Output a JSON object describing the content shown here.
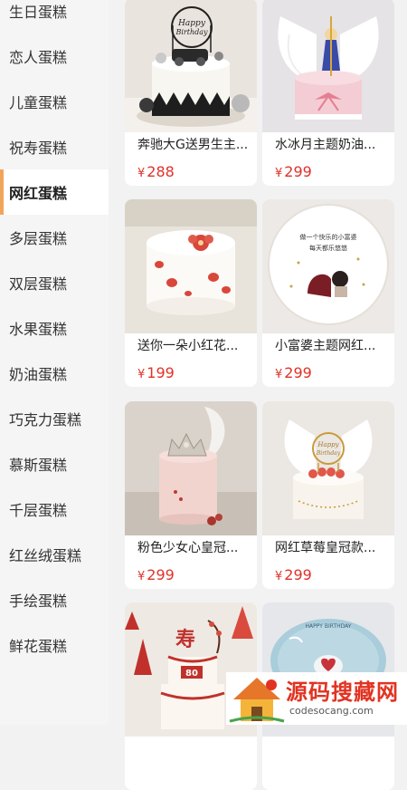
{
  "sidebar": {
    "items": [
      {
        "label": "生日蛋糕"
      },
      {
        "label": "恋人蛋糕"
      },
      {
        "label": "儿童蛋糕"
      },
      {
        "label": "祝寿蛋糕"
      },
      {
        "label": "网红蛋糕"
      },
      {
        "label": "多层蛋糕"
      },
      {
        "label": "双层蛋糕"
      },
      {
        "label": "水果蛋糕"
      },
      {
        "label": "奶油蛋糕"
      },
      {
        "label": "巧克力蛋糕"
      },
      {
        "label": "慕斯蛋糕"
      },
      {
        "label": "千层蛋糕"
      },
      {
        "label": "红丝绒蛋糕"
      },
      {
        "label": "手绘蛋糕"
      },
      {
        "label": "鲜花蛋糕"
      }
    ],
    "active_index": 4
  },
  "currency_symbol": "¥",
  "products": [
    {
      "title": "奔驰大G送男生主...",
      "price": "288",
      "cake_text": "Happy Birthday"
    },
    {
      "title": "水冰月主题奶油...",
      "price": "299"
    },
    {
      "title": "送你一朵小红花...",
      "price": "199"
    },
    {
      "title": "小富婆主题网红...",
      "price": "299",
      "cake_text": "做一个快乐的小富婆 每天都乐悠悠"
    },
    {
      "title": "粉色少女心皇冠...",
      "price": "299"
    },
    {
      "title": "网红草莓皇冠款...",
      "price": "299",
      "cake_text": "Happy Birthday"
    },
    {
      "title": "",
      "price": "",
      "cake_text": "寿 80"
    },
    {
      "title": "",
      "price": "",
      "cake_text": "HAPPY BIRTHDAY"
    }
  ],
  "watermark": {
    "title": "源码搜藏网",
    "subtitle": "codesocang.com"
  },
  "colors": {
    "accent": "#f2a55a",
    "price": "#e0322a"
  }
}
